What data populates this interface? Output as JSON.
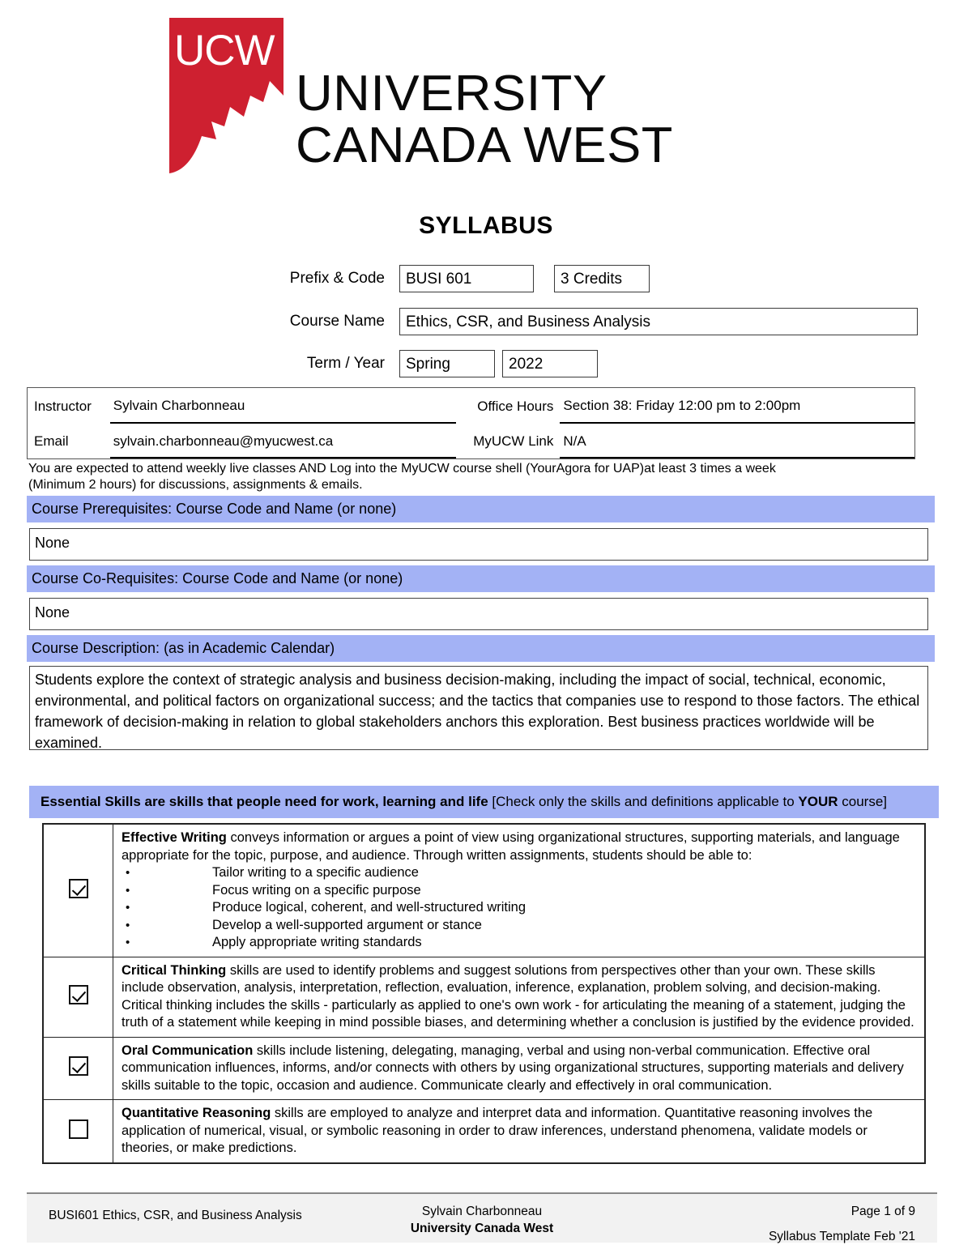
{
  "logo": {
    "mark_text": "UCW",
    "wordmark_line1": "UNIVERSITY",
    "wordmark_line2": "CANADA WEST",
    "brand_red": "#ce2030"
  },
  "title": "SYLLABUS",
  "header_fields": {
    "prefix_label": "Prefix & Code",
    "prefix_value": "BUSI 601",
    "credits_value": "3 Credits",
    "course_name_label": "Course Name",
    "course_name_value": "Ethics, CSR, and Business Analysis",
    "term_label": "Term / Year",
    "term_value": "Spring",
    "year_value": "2022"
  },
  "instructor_table": {
    "instructor_label": "Instructor",
    "instructor_value": "Sylvain Charbonneau",
    "office_hours_label": "Office Hours",
    "office_hours_value": "Section 38: Friday 12:00 pm to 2:00pm",
    "email_label": "Email",
    "email_value": "sylvain.charbonneau@myucwest.ca",
    "myucw_label": "MyUCW Link",
    "myucw_value": "N/A"
  },
  "attendance_note_line1": "You are expected to attend weekly live classes AND Log into the MyUCW course shell (YourAgora for UAP)at least 3 times a week",
  "attendance_note_line2": "(Minimum 2 hours) for discussions, assignments & emails.",
  "sections": {
    "prerequisites_header": "Course Prerequisites:  Course Code and Name (or none)",
    "prerequisites_value": "None",
    "corequisites_header": "Course Co-Requisites:  Course Code and Name (or none)",
    "corequisites_value": "None",
    "description_header": "Course Description: (as in Academic Calendar)",
    "description_value": "Students explore the context of strategic analysis and business decision-making, including the impact of social, technical, economic, environmental, and political factors on organizational success; and the tactics that companies use to respond to those factors. The ethical framework of decision-making in relation to global stakeholders anchors this exploration. Best business practices worldwide will be examined."
  },
  "essential_skills": {
    "banner_bold": "Essential Skills are skills that people need for work, learning and life",
    "banner_rest_pre": " [Check only the skills and definitions applicable to ",
    "banner_your": "YOUR",
    "banner_rest_post": " course]",
    "rows": [
      {
        "checked": true,
        "title": "Effective Writing",
        "body": " conveys information or argues a point of view using organizational structures, supporting materials, and language appropriate for the topic, purpose, and audience. Through written assignments, students should be able to:",
        "bullets": [
          "Tailor writing to a specific audience",
          "Focus writing on a specific purpose",
          "Produce logical, coherent, and well-structured writing",
          "Develop a well-supported argument or stance",
          "Apply appropriate writing standards"
        ]
      },
      {
        "checked": true,
        "title": "Critical Thinking",
        "body": " skills are used to identify problems and suggest solutions from perspectives other than your own. These skills include observation, analysis, interpretation, reflection, evaluation, inference, explanation, problem solving, and decision-making. Critical thinking includes the skills - particularly as applied to one's own work - for articulating the meaning of a statement, judging the truth of a statement while keeping in mind possible biases, and determining whether a conclusion is justified by the evidence provided.",
        "bullets": []
      },
      {
        "checked": true,
        "title": "Oral Communication",
        "body": " skills include listening, delegating, managing, verbal and using non-verbal communication. Effective oral communication influences, informs, and/or connects with others by using organizational structures, supporting materials and delivery skills suitable to the topic, occasion and audience. Communicate clearly and effectively in oral communication.",
        "bullets": []
      },
      {
        "checked": false,
        "title": "Quantitative Reasoning",
        "body": " skills are employed to analyze and interpret data and information. Quantitative reasoning involves the application of numerical, visual, or symbolic reasoning in order to draw inferences, understand phenomena, validate models or theories, or make predictions.",
        "bullets": []
      }
    ]
  },
  "footer": {
    "left": "BUSI601 Ethics, CSR, and Business Analysis",
    "center_name": "Sylvain Charbonneau",
    "center_institution": "University Canada West",
    "page": "Page 1 of 9",
    "template": "Syllabus Template Feb '21"
  }
}
